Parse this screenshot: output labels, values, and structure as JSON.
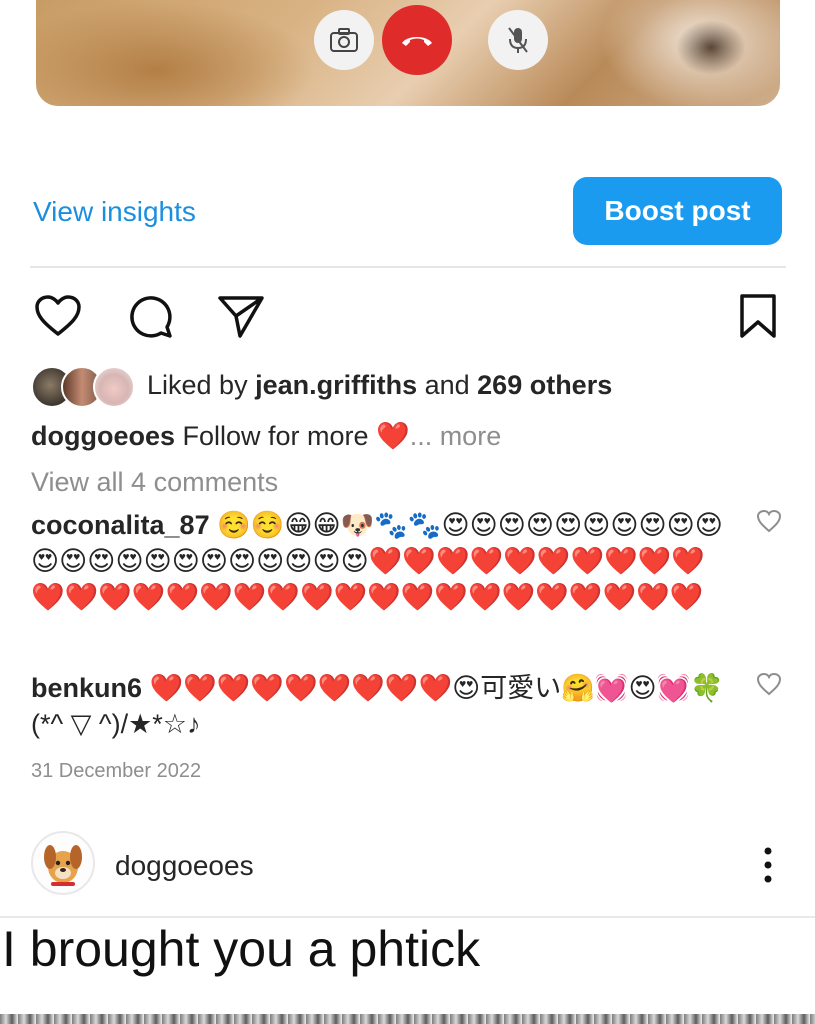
{
  "call_controls": {
    "camera_icon": "camera-flip-icon",
    "end_call_icon": "phone-hangup-icon",
    "mute_icon": "mic-off-icon",
    "end_call_color": "#e02b2b"
  },
  "insights": {
    "view_insights_label": "View insights",
    "boost_post_label": "Boost post",
    "accent_color": "#1a9bf0"
  },
  "actions": [
    "heart-icon",
    "comment-icon",
    "share-icon",
    "bookmark-icon"
  ],
  "likes": {
    "prefix": "Liked by ",
    "user": "jean.griffiths",
    "middle": " and ",
    "others": "269 others"
  },
  "caption": {
    "username": "doggoeoes",
    "text": " Follow for more ❤️",
    "more": "... more"
  },
  "view_all_comments": "View all 4 comments",
  "comments": [
    {
      "username": "coconalita_87",
      "text": " ☺️☺️😁😁🐶🐾🐾😍😍😍😍😍😍😍😍😍😍😍😍😍😍😍😍😍😍😍😍😍😍❤️❤️❤️❤️❤️❤️❤️❤️❤️❤️❤️❤️❤️❤️❤️❤️❤️❤️❤️❤️❤️❤️❤️❤️❤️❤️❤️❤️❤️❤️"
    },
    {
      "username": "benkun6",
      "text": " ❤️❤️❤️❤️❤️❤️❤️❤️❤️😍可愛い🤗💓😍💓🍀(*^ ▽ ^)/★*☆♪"
    }
  ],
  "post_date": "31 December 2022",
  "next_post": {
    "username": "doggoeoes",
    "caption_image_text": "I brought you a phtick"
  }
}
